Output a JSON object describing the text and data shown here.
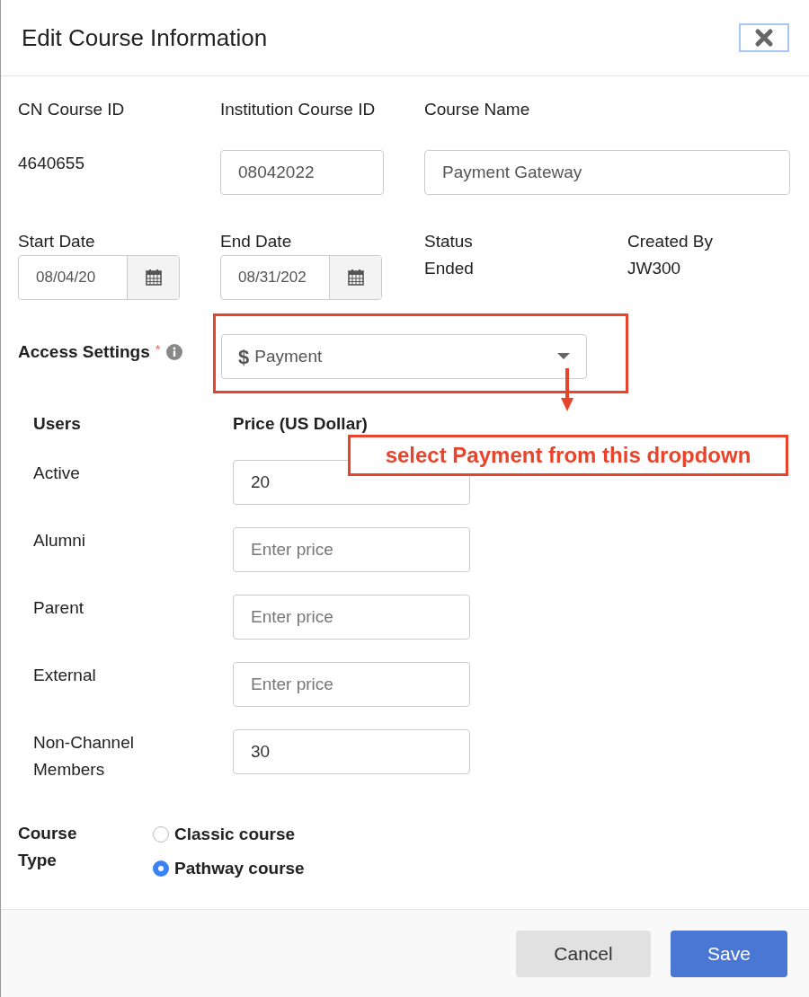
{
  "dialog": {
    "title": "Edit Course Information"
  },
  "row_1": [
    {
      "kind": "text",
      "label": "CN Course ID",
      "value": "4640655"
    },
    {
      "kind": "input",
      "label": "Institution Course ID",
      "value": "08042022"
    },
    {
      "kind": "input",
      "label": "Course Name",
      "value": "Payment Gateway"
    }
  ],
  "row_2": [
    {
      "kind": "date",
      "label": "Start Date",
      "value": "08/04/20"
    },
    {
      "kind": "date",
      "label": "End Date",
      "value": "08/31/202"
    },
    {
      "kind": "text",
      "label": "Status",
      "value": "Ended"
    },
    {
      "kind": "text",
      "label": "Created By",
      "value": "JW300"
    }
  ],
  "access_settings": {
    "label": "Access Settings",
    "required_mark": "*",
    "currency_symbol": "$",
    "value": "Payment"
  },
  "pricing": {
    "columns": [
      "Users",
      "Price (US Dollar)"
    ],
    "rows": [
      {
        "user": "Active",
        "value": "20"
      },
      {
        "user": "Alumni",
        "placeholder": "Enter price"
      },
      {
        "user": "Parent",
        "placeholder": "Enter price"
      },
      {
        "user": "External",
        "placeholder": "Enter price"
      },
      {
        "user": "Non-Channel Members",
        "value": "30"
      }
    ]
  },
  "course_type": {
    "label": "Course Type",
    "options": [
      {
        "label": "Classic course",
        "selected": false
      },
      {
        "label": "Pathway course",
        "selected": true
      }
    ]
  },
  "annotation": {
    "text": "select Payment from this dropdown"
  },
  "buttons": [
    {
      "kind": "secondary",
      "label": "Cancel"
    },
    {
      "kind": "primary",
      "label": "Save"
    }
  ]
}
